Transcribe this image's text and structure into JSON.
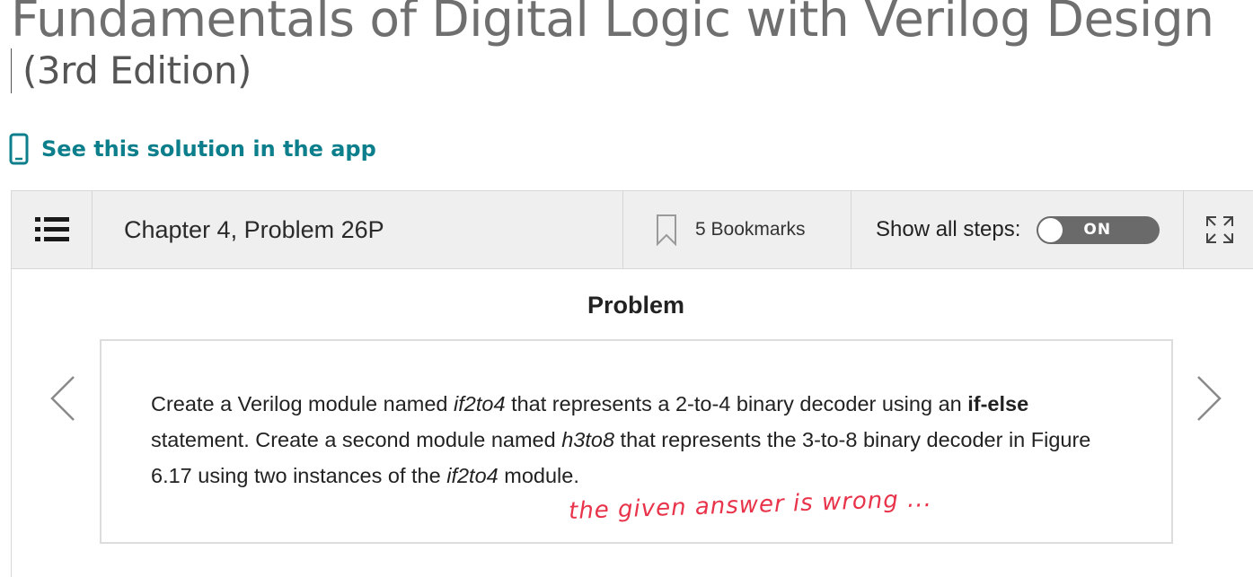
{
  "book": {
    "title_line1": "Fundamentals of Digital Logic with Verilog Design",
    "title_line2": "(3rd Edition)"
  },
  "app_link": {
    "label": "See this solution in the app",
    "icon": "phone-icon"
  },
  "toolbar": {
    "menu_icon": "list-icon",
    "chapter_label": "Chapter 4, Problem 26P",
    "bookmark_icon": "bookmark-icon",
    "bookmarks_label": "5 Bookmarks",
    "show_steps_label": "Show all steps:",
    "toggle_state": "ON",
    "expand_icon": "expand-icon"
  },
  "problem": {
    "heading": "Problem",
    "parts": [
      {
        "t": "Create a Verilog module named ",
        "s": "n"
      },
      {
        "t": "if2to4",
        "s": "i"
      },
      {
        "t": " that represents a 2-to-4 binary decoder using an ",
        "s": "n"
      },
      {
        "t": "if-else",
        "s": "b"
      },
      {
        "t": " statement. Create a second module named ",
        "s": "n"
      },
      {
        "t": "h3to8",
        "s": "i"
      },
      {
        "t": " that represents the 3-to-8 binary decoder in Figure 6.17 using two instances of the ",
        "s": "n"
      },
      {
        "t": "if2to4",
        "s": "i"
      },
      {
        "t": " module.",
        "s": "n"
      }
    ],
    "annotation": "the given answer is wrong ..."
  },
  "nav": {
    "prev_icon": "chevron-left-icon",
    "next_icon": "chevron-right-icon"
  },
  "colors": {
    "accent": "#0d7f8c",
    "annotation": "#e8334a",
    "toolbar_bg": "#efefef",
    "toggle_bg": "#6a6a6a"
  }
}
